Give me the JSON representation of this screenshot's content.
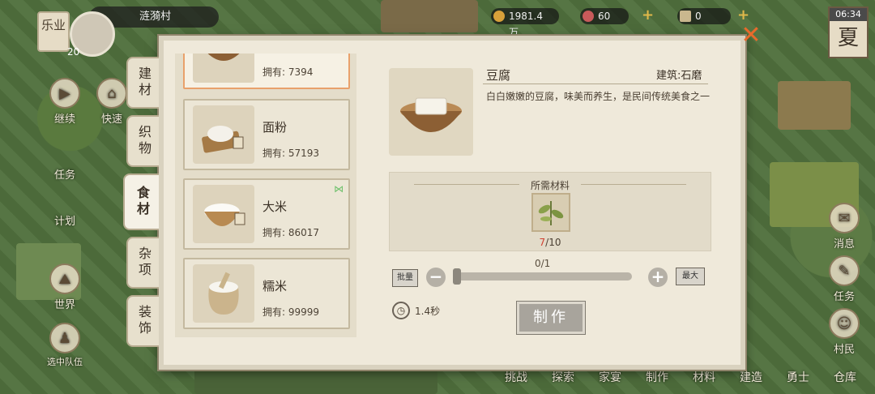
{
  "hud": {
    "leye_label": "乐业",
    "village_name": "涟漪村",
    "player_level": "20",
    "coins": "1981.4万",
    "gems": "60",
    "tickets": "0",
    "time": "06:34",
    "season": "夏"
  },
  "left_nav": [
    {
      "label": "继续",
      "icon": "play-icon"
    },
    {
      "label": "快速",
      "icon": "house-icon"
    },
    {
      "label": "任务",
      "icon": "scroll-icon"
    },
    {
      "label": "计划",
      "icon": "plan-icon"
    },
    {
      "label": "世界",
      "icon": "world-icon"
    },
    {
      "label": "选中队伍",
      "icon": "team-icon"
    }
  ],
  "right_nav": [
    {
      "label": "消息",
      "icon": "message-icon"
    },
    {
      "label": "任务",
      "icon": "task-icon"
    },
    {
      "label": "村民",
      "icon": "villager-icon"
    },
    {
      "label": "仓库",
      "icon": "warehouse-icon"
    }
  ],
  "bottom_nav": [
    "挑战",
    "探索",
    "家宴",
    "制作",
    "材料",
    "建造",
    "勇士",
    "仓库"
  ],
  "tabs": [
    {
      "label": "建材",
      "active": false
    },
    {
      "label": "织物",
      "active": false
    },
    {
      "label": "食材",
      "active": true
    },
    {
      "label": "杂项",
      "active": false
    },
    {
      "label": "装饰",
      "active": false
    }
  ],
  "items": [
    {
      "name": "",
      "own": "拥有: 7394",
      "icon": "tofu-bowl-icon",
      "selected": true
    },
    {
      "name": "面粉",
      "own": "拥有: 57193",
      "icon": "flour-icon",
      "selected": false
    },
    {
      "name": "大米",
      "own": "拥有: 86017",
      "icon": "rice-basket-icon",
      "selected": false,
      "flag": "⋈"
    },
    {
      "name": "糯米",
      "own": "拥有: 99999",
      "icon": "glutinous-rice-sack-icon",
      "selected": false
    }
  ],
  "detail": {
    "name": "豆腐",
    "building": "建筑:石磨",
    "description": "白白嫩嫩的豆腐，味美而养生，是民间传统美食之一",
    "required_title": "所需材料",
    "material_icon": "soybean-plant-icon",
    "have": "7",
    "need": "/10",
    "quantity": "0/1",
    "auto_label": "批量",
    "max_label": "最大",
    "time": "1.4秒",
    "make_label": "制作"
  },
  "colors": {
    "panel": "#efe9da",
    "accent_close": "#e96a2b",
    "insufficient": "#d04030"
  }
}
